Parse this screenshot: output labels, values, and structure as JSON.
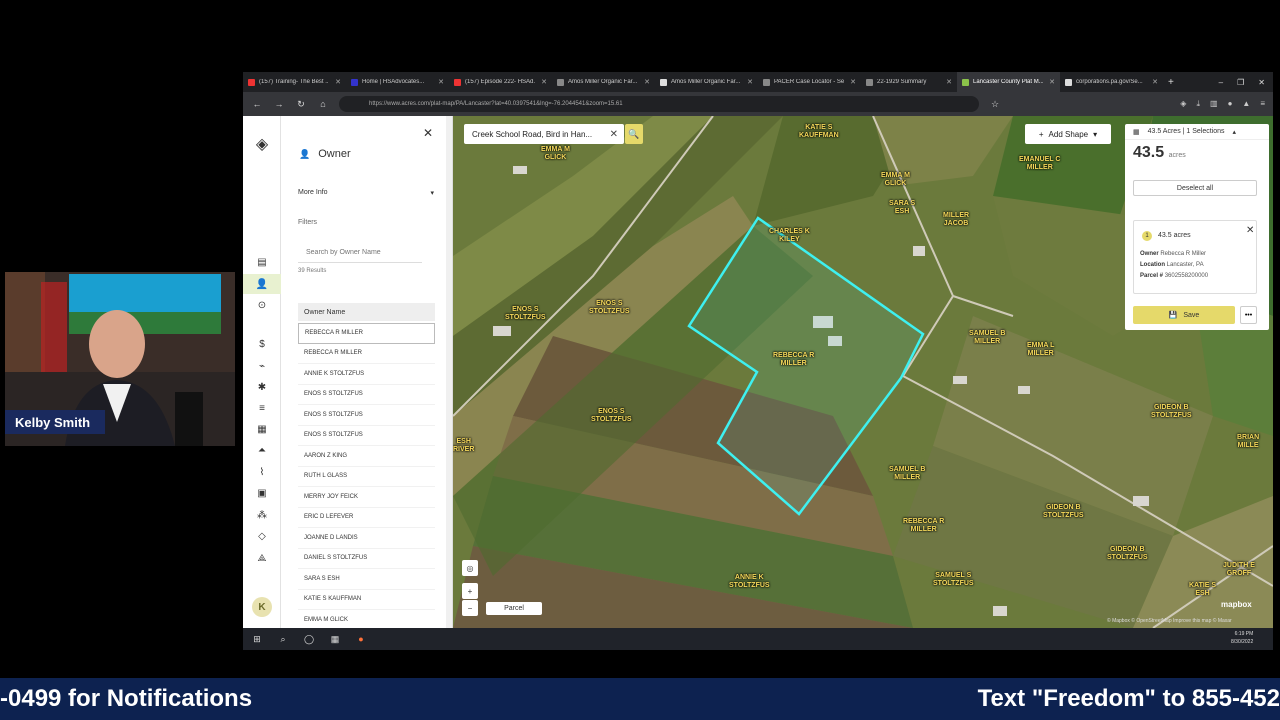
{
  "browser": {
    "tabs": [
      {
        "label": "(157) Training- The Best ...",
        "color": "#e33"
      },
      {
        "label": "Home | HSAdvocates...",
        "color": "#33c"
      },
      {
        "label": "(157) Episode 222- HSAd...",
        "color": "#e33"
      },
      {
        "label": "Amos Miller Organic Far...",
        "color": "#888"
      },
      {
        "label": "Amos Miller Organic Far...",
        "color": "#ddd"
      },
      {
        "label": "PACER Case Locator - Se...",
        "color": "#888"
      },
      {
        "label": "22-1929 Summary",
        "color": "#888"
      },
      {
        "label": "Lancaster County Plat M...",
        "color": "#8bc34a"
      },
      {
        "label": "corporations.pa.gov/Se...",
        "color": "#ddd"
      }
    ],
    "url": "https://www.acres.com/plat-map/PA/Lancaster?lat=40.0397541&lng=-76.2044541&zoom=15.61"
  },
  "panel": {
    "title": "Owner",
    "more_info": "More Info",
    "filters": "Filters",
    "search_placeholder": "Search by Owner Name",
    "results": "39 Results",
    "owner_header": "Owner Name",
    "owners": [
      "REBECCA R MILLER",
      "REBECCA R MILLER",
      "ANNIE K STOLTZFUS",
      "ENOS S STOLTZFUS",
      "ENOS S STOLTZFUS",
      "ENOS S STOLTZFUS",
      "AARON Z KING",
      "RUTH L GLASS",
      "MERRY JOY FEICK",
      "ERIC D LEFEVER",
      "JOANNE D LANDIS",
      "DANIEL S STOLTZFUS",
      "SARA S ESH",
      "KATIE S KAUFFMAN",
      "EMMA M GLICK"
    ],
    "avatar": "K"
  },
  "map": {
    "search_value": "Creek School Road, Bird in Han...",
    "add_shape": "Add Shape",
    "selection_header": "43.5 Acres | 1 Selections",
    "selection_big": "43.5",
    "selection_unit": "acres",
    "deselect": "Deselect all",
    "parcel": {
      "index": "1",
      "acres": "43.5 acres",
      "owner_label": "Owner",
      "owner_value": "Rebecca R Miller",
      "location_label": "Location",
      "location_value": "Lancaster, PA",
      "parcel_label": "Parcel #",
      "parcel_value": "3602558200000"
    },
    "save": "Save",
    "more": "•••",
    "parcel_toggle": "Parcel",
    "mapbox": "mapbox",
    "attribution": "© Mapbox © OpenStreetMap Improve this map © Maxar",
    "labels": [
      {
        "text": "KATIE S\nKAUFFMAN"
      },
      {
        "text": "EMMA M\nGLICK"
      },
      {
        "text": "EMMA M\nGLICK"
      },
      {
        "text": "CHARLES K\nKILEY"
      },
      {
        "text": "SARA S\nESH"
      },
      {
        "text": "MILLER\nJACOB"
      },
      {
        "text": "EMANUEL C\nMILLER"
      },
      {
        "text": "ENOS S\nSTOLTZFUS"
      },
      {
        "text": "ENOS S\nSTOLTZFUS"
      },
      {
        "text": "REBECCA R\nMILLER"
      },
      {
        "text": "SAMUEL B\nMILLER"
      },
      {
        "text": "EMMA L\nMILLER"
      },
      {
        "text": "ENOS S\nSTOLTZFUS"
      },
      {
        "text": "GIDEON B\nSTOLTZFUS"
      },
      {
        "text": "SAMUEL B\nMILLER"
      },
      {
        "text": "GIDEON B\nSTOLTZFUS"
      },
      {
        "text": "REBECCA R\nMILLER"
      },
      {
        "text": "GIDEON B\nSTOLTZFUS"
      },
      {
        "text": "ANNIE K\nSTOLTZFUS"
      },
      {
        "text": "SAMUEL S\nSTOLTZFUS"
      },
      {
        "text": "KATIE S\nESH"
      },
      {
        "text": "JUDITH E\nGROFF"
      },
      {
        "text": "ESH\nRIVER"
      },
      {
        "text": "BRIAN\nMILLE"
      }
    ]
  },
  "taskbar": {
    "time": "6:19 PM",
    "date": "8/30/2022"
  },
  "webcam": {
    "name": "Kelby Smith"
  },
  "ticker": {
    "left": "-0499 for Notifications",
    "right": "Text \"Freedom\" to 855-452"
  },
  "colors": {
    "parcel_outline": "#3ef0f0",
    "accent": "#e5d96a",
    "ticker_bg": "#0d2250"
  }
}
